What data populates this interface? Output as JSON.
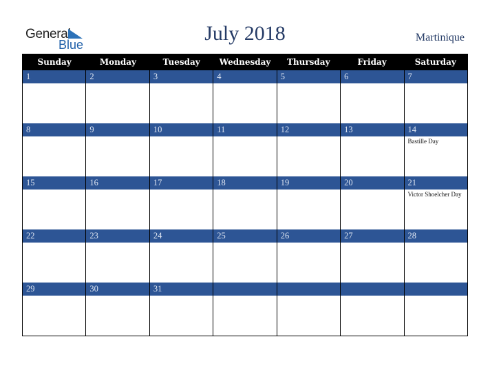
{
  "logo": {
    "line1": "General",
    "line2": "Blue"
  },
  "title": "July 2018",
  "country": "Martinique",
  "weekdays": [
    "Sunday",
    "Monday",
    "Tuesday",
    "Wednesday",
    "Thursday",
    "Friday",
    "Saturday"
  ],
  "weeks": [
    [
      {
        "d": "1",
        "h": ""
      },
      {
        "d": "2",
        "h": ""
      },
      {
        "d": "3",
        "h": ""
      },
      {
        "d": "4",
        "h": ""
      },
      {
        "d": "5",
        "h": ""
      },
      {
        "d": "6",
        "h": ""
      },
      {
        "d": "7",
        "h": ""
      }
    ],
    [
      {
        "d": "8",
        "h": ""
      },
      {
        "d": "9",
        "h": ""
      },
      {
        "d": "10",
        "h": ""
      },
      {
        "d": "11",
        "h": ""
      },
      {
        "d": "12",
        "h": ""
      },
      {
        "d": "13",
        "h": ""
      },
      {
        "d": "14",
        "h": "Bastille Day"
      }
    ],
    [
      {
        "d": "15",
        "h": ""
      },
      {
        "d": "16",
        "h": ""
      },
      {
        "d": "17",
        "h": ""
      },
      {
        "d": "18",
        "h": ""
      },
      {
        "d": "19",
        "h": ""
      },
      {
        "d": "20",
        "h": ""
      },
      {
        "d": "21",
        "h": "Victor Shoelcher Day"
      }
    ],
    [
      {
        "d": "22",
        "h": ""
      },
      {
        "d": "23",
        "h": ""
      },
      {
        "d": "24",
        "h": ""
      },
      {
        "d": "25",
        "h": ""
      },
      {
        "d": "26",
        "h": ""
      },
      {
        "d": "27",
        "h": ""
      },
      {
        "d": "28",
        "h": ""
      }
    ],
    [
      {
        "d": "29",
        "h": ""
      },
      {
        "d": "30",
        "h": ""
      },
      {
        "d": "31",
        "h": ""
      },
      {
        "d": "",
        "h": ""
      },
      {
        "d": "",
        "h": ""
      },
      {
        "d": "",
        "h": ""
      },
      {
        "d": "",
        "h": ""
      }
    ]
  ]
}
